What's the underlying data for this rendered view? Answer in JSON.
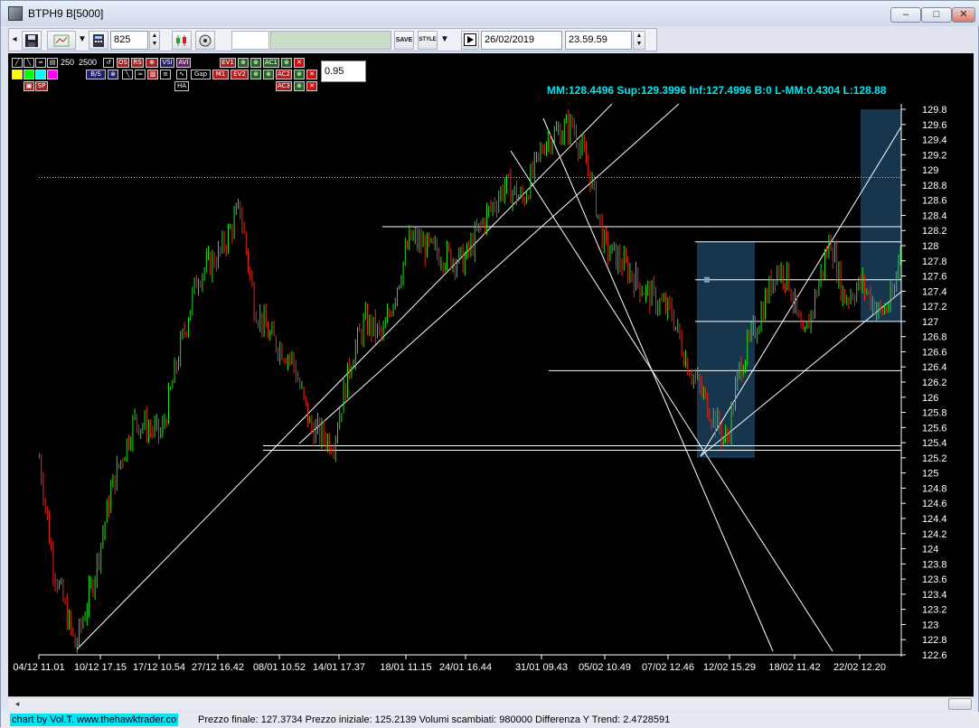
{
  "window": {
    "title": "BTPH9 B[5000]",
    "min_label": "–",
    "max_label": "□",
    "close_label": "✕"
  },
  "toolbar": {
    "bars_value": "825",
    "save_label": "SAVE",
    "style_label": "STYLE",
    "date": "26/02/2019",
    "time": "23.59.59"
  },
  "indicators": {
    "row1": [
      "250",
      "2500"
    ],
    "tags": [
      "OS",
      "RS",
      "VSI",
      "AVI",
      "EV1",
      "AC1",
      "EV2",
      "AC2",
      "AC3",
      "B/S",
      "Gap",
      "HA"
    ],
    "threshold": "0.95"
  },
  "header_stats": "MM:128.4496 Sup:129.3996 Inf:127.4996 B:0 L-MM:0.4304 L:128.88",
  "chart_data": {
    "type": "candlestick",
    "ylim": [
      122.6,
      129.8
    ],
    "yticks": [
      "129.8",
      "129.6",
      "129.4",
      "129.2",
      "129",
      "128.8",
      "128.6",
      "128.4",
      "128.2",
      "128",
      "127.8",
      "127.6",
      "127.4",
      "127.2",
      "127",
      "126.8",
      "126.6",
      "126.4",
      "126.2",
      "126",
      "125.8",
      "125.6",
      "125.4",
      "125.2",
      "125",
      "124.8",
      "124.6",
      "124.4",
      "124.2",
      "124",
      "123.8",
      "123.6",
      "123.4",
      "123.2",
      "123",
      "122.8",
      "122.6"
    ],
    "xticks": [
      "04/12 11.01",
      "10/12 17.15",
      "17/12 10.54",
      "27/12 16.42",
      "08/01 10.52",
      "14/01 17.37",
      "18/01 11.15",
      "24/01 16.44",
      "31/01 09.43",
      "05/02 10.49",
      "07/02 12.46",
      "12/02 15.29",
      "18/02 11.42",
      "22/02 12.20"
    ],
    "path": [
      [
        0,
        125.2
      ],
      [
        15,
        123.8
      ],
      [
        40,
        122.7
      ],
      [
        60,
        123.6
      ],
      [
        80,
        124.8
      ],
      [
        105,
        125.7
      ],
      [
        135,
        125.5
      ],
      [
        155,
        126.6
      ],
      [
        175,
        127.6
      ],
      [
        200,
        127.9
      ],
      [
        222,
        128.5
      ],
      [
        238,
        127.2
      ],
      [
        255,
        126.8
      ],
      [
        280,
        126.5
      ],
      [
        300,
        125.6
      ],
      [
        325,
        125.4
      ],
      [
        345,
        126.5
      ],
      [
        360,
        127.0
      ],
      [
        380,
        126.8
      ],
      [
        410,
        128.1
      ],
      [
        440,
        127.9
      ],
      [
        470,
        127.8
      ],
      [
        490,
        128.3
      ],
      [
        515,
        128.8
      ],
      [
        535,
        128.6
      ],
      [
        560,
        129.4
      ],
      [
        590,
        129.6
      ],
      [
        610,
        128.9
      ],
      [
        625,
        128.0
      ],
      [
        650,
        127.7
      ],
      [
        670,
        127.4
      ],
      [
        700,
        127.1
      ],
      [
        715,
        126.5
      ],
      [
        735,
        126.0
      ],
      [
        760,
        125.4
      ],
      [
        775,
        126.4
      ],
      [
        795,
        127.0
      ],
      [
        815,
        127.7
      ],
      [
        828,
        127.6
      ],
      [
        845,
        126.7
      ],
      [
        860,
        127.4
      ],
      [
        875,
        128.1
      ],
      [
        890,
        127.3
      ],
      [
        910,
        127.5
      ],
      [
        930,
        127.1
      ],
      [
        945,
        127.3
      ],
      [
        955,
        128.3
      ],
      [
        965,
        128.0
      ],
      [
        990,
        128.8
      ]
    ],
    "support_lines": [
      125.3,
      125.36,
      126.35,
      127.0,
      127.55,
      128.05,
      128.25
    ],
    "dotted_level": 128.9,
    "shaded_boxes": [
      [
        125.2,
        128.05
      ],
      [
        127.0,
        129.8
      ]
    ],
    "colors": {
      "up": "#1ee01e",
      "down": "#e8281e",
      "lines": "#ffffff",
      "box": "#1b3f5c",
      "stats": "#00e5f0"
    }
  },
  "status": {
    "credit": "chart by Vol.T. www.thehawktrader.co",
    "stats": "Prezzo finale: 127.3734 Prezzo iniziale: 125.2139 Volumi scambiati: 980000 Differenza Y Trend: 2.4728591"
  }
}
